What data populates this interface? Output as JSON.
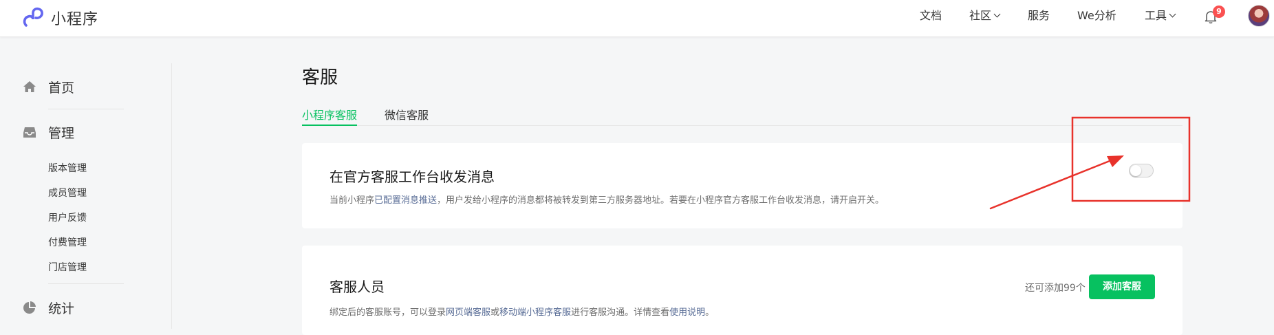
{
  "header": {
    "app_name": "小程序",
    "nav": [
      {
        "label": "文档",
        "dropdown": false
      },
      {
        "label": "社区",
        "dropdown": true
      },
      {
        "label": "服务",
        "dropdown": false
      },
      {
        "label": "We分析",
        "dropdown": false
      },
      {
        "label": "工具",
        "dropdown": true
      }
    ],
    "notification_count": "9",
    "icons": {
      "logo": "miniprogram-logo-icon",
      "bell": "bell-icon",
      "avatar": "user-avatar"
    }
  },
  "sidebar": {
    "home": {
      "label": "首页",
      "icon": "home-icon"
    },
    "manage": {
      "label": "管理",
      "icon": "inbox-icon"
    },
    "manage_items": [
      "版本管理",
      "成员管理",
      "用户反馈",
      "付费管理",
      "门店管理"
    ],
    "stats": {
      "label": "统计",
      "icon": "pie-chart-icon"
    }
  },
  "main": {
    "title": "客服",
    "tabs": [
      {
        "label": "小程序客服",
        "active": true
      },
      {
        "label": "微信客服",
        "active": false
      }
    ],
    "workbench": {
      "title": "在官方客服工作台收发消息",
      "desc_prefix": "当前小程序",
      "desc_link": "已配置消息推送",
      "desc_suffix": "，用户发给小程序的消息都将被转发到第三方服务器地址。若要在小程序官方客服工作台收发消息，请开启开关。",
      "switch_on": false
    },
    "staff": {
      "title": "客服人员",
      "quota": "还可添加99个",
      "add_button": "添加客服",
      "desc_1": "绑定后的客服账号，可以登录",
      "link_1": "网页端客服",
      "desc_2": "或",
      "link_2": "移动端小程序客服",
      "desc_3": "进行客服沟通。详情查看",
      "link_3": "使用说明",
      "desc_4": "。"
    }
  },
  "colors": {
    "accent_green": "#07c160",
    "link_blue": "#576b95",
    "badge_red": "#fa5151",
    "annotation_red": "#e8322b",
    "page_bg": "#f5f6f7"
  }
}
